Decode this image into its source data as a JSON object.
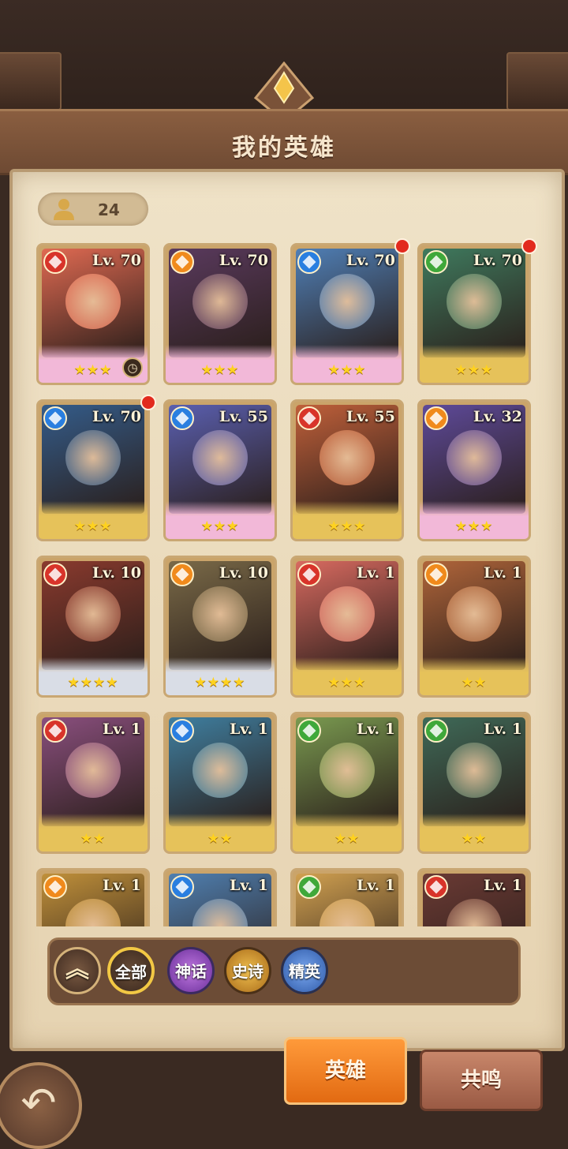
{
  "header": {
    "title": "我的英雄"
  },
  "hero_count": "24",
  "heroes": [
    {
      "level": "Lv. 70",
      "element": "fire",
      "stars": "★★★",
      "tier": "mythic",
      "badge": true,
      "timer": true
    },
    {
      "level": "Lv. 70",
      "element": "light",
      "stars": "★★★",
      "tier": "mythic"
    },
    {
      "level": "Lv. 70",
      "element": "water",
      "stars": "★★★",
      "tier": "mythic",
      "dot": true
    },
    {
      "level": "Lv. 70",
      "element": "earth",
      "stars": "★★★",
      "tier": "epic",
      "dot": true
    },
    {
      "level": "Lv. 70",
      "element": "water",
      "stars": "★★★",
      "tier": "epic",
      "dot": true
    },
    {
      "level": "Lv. 55",
      "element": "water",
      "stars": "★★★",
      "tier": "mythic"
    },
    {
      "level": "Lv. 55",
      "element": "fire",
      "stars": "★★★",
      "tier": "epic"
    },
    {
      "level": "Lv. 32",
      "element": "light",
      "stars": "★★★",
      "tier": "mythic"
    },
    {
      "level": "Lv. 10",
      "element": "fire",
      "stars": "★★★★",
      "tier": "elite"
    },
    {
      "level": "Lv. 10",
      "element": "light",
      "stars": "★★★★",
      "tier": "elite"
    },
    {
      "level": "Lv. 1",
      "element": "fire",
      "stars": "★★★",
      "tier": "epic"
    },
    {
      "level": "Lv. 1",
      "element": "light",
      "stars": "★★",
      "tier": "epic"
    },
    {
      "level": "Lv. 1",
      "element": "fire",
      "stars": "★★",
      "tier": "epic"
    },
    {
      "level": "Lv. 1",
      "element": "water",
      "stars": "★★",
      "tier": "epic"
    },
    {
      "level": "Lv. 1",
      "element": "earth",
      "stars": "★★",
      "tier": "epic"
    },
    {
      "level": "Lv. 1",
      "element": "earth",
      "stars": "★★",
      "tier": "epic"
    },
    {
      "level": "Lv. 1",
      "element": "light",
      "stars": "",
      "tier": "epic"
    },
    {
      "level": "Lv. 1",
      "element": "water",
      "stars": "",
      "tier": "epic"
    },
    {
      "level": "Lv. 1",
      "element": "earth",
      "stars": "",
      "tier": "epic"
    },
    {
      "level": "Lv. 1",
      "element": "fire",
      "stars": "",
      "tier": "epic"
    }
  ],
  "filters": {
    "all": "全部",
    "mythic": "神话",
    "epic": "史诗",
    "elite": "精英"
  },
  "tabs": {
    "heroes": "英雄",
    "resonance": "共鸣"
  },
  "colors": {
    "fire": "#d8342a",
    "light": "#f08a1c",
    "water": "#2a7fe0",
    "earth": "#3fa83a",
    "mythic_frame": "#f2b8d8",
    "epic_frame": "#e6c25a",
    "elite_frame": "#d9dde6"
  },
  "art_colors": [
    "#e06a52",
    "#5a3a5e",
    "#4f7fb6",
    "#3f7a5e",
    "#345c8a",
    "#5a5fb0",
    "#c0603a",
    "#5e4a9a",
    "#8a3a2e",
    "#7a6a48",
    "#d86a60",
    "#b0653a",
    "#8a4f7e",
    "#3f7fa0",
    "#7a9a50",
    "#3f6a58",
    "#c0903a",
    "#4f7fb0",
    "#d0a050",
    "#6a3a34"
  ]
}
